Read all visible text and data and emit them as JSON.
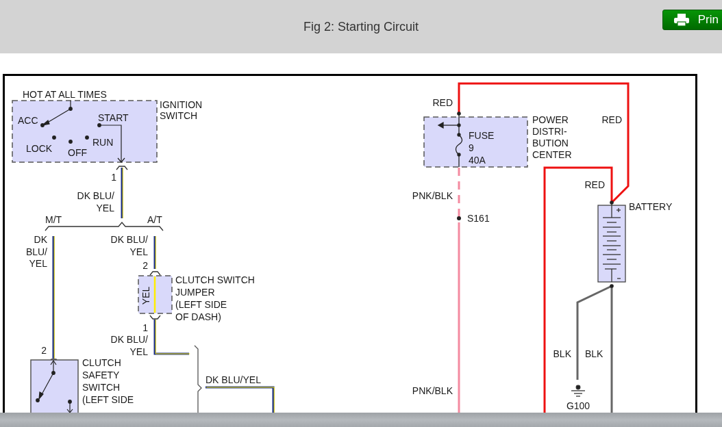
{
  "header": {
    "title": "Fig 2: Starting Circuit",
    "print_button": "Prin"
  },
  "diagram": {
    "labels": [
      {
        "lines": [
          "HOT AT ALL TIMES"
        ]
      },
      {
        "lines": [
          "IGNITION",
          "SWITCH"
        ]
      },
      {
        "lines": [
          "ACC"
        ]
      },
      {
        "lines": [
          "START"
        ]
      },
      {
        "lines": [
          "LOCK"
        ]
      },
      {
        "lines": [
          "OFF"
        ]
      },
      {
        "lines": [
          "RUN"
        ]
      },
      {
        "lines": [
          "1"
        ]
      },
      {
        "lines": [
          "DK BLU/",
          "YEL"
        ]
      },
      {
        "lines": [
          "M/T"
        ]
      },
      {
        "lines": [
          "A/T"
        ]
      },
      {
        "lines": [
          "DK",
          "BLU/",
          "YEL"
        ]
      },
      {
        "lines": [
          "DK BLU/",
          "YEL"
        ]
      },
      {
        "lines": [
          "2"
        ]
      },
      {
        "lines": [
          "CLUTCH SWITCH",
          "JUMPER",
          "(LEFT SIDE",
          "OF DASH)"
        ]
      },
      {
        "lines": [
          "YEL"
        ]
      },
      {
        "lines": [
          "1"
        ]
      },
      {
        "lines": [
          "2"
        ]
      },
      {
        "lines": [
          "DK BLU/",
          "YEL"
        ]
      },
      {
        "lines": [
          "CLUTCH",
          "SAFETY",
          "SWITCH",
          "(LEFT SIDE"
        ]
      },
      {
        "lines": [
          "DK BLU/YEL"
        ]
      },
      {
        "lines": [
          "RED"
        ]
      },
      {
        "lines": [
          "POWER",
          "DISTRI-",
          "BUTION",
          "CENTER"
        ]
      },
      {
        "lines": [
          "FUSE",
          "9",
          "40A"
        ]
      },
      {
        "lines": [
          "RED"
        ]
      },
      {
        "lines": [
          "RED"
        ]
      },
      {
        "lines": [
          "BATTERY"
        ]
      },
      {
        "lines": [
          "PNK/BLK"
        ]
      },
      {
        "lines": [
          "S161"
        ]
      },
      {
        "lines": [
          "PNK/BLK"
        ]
      },
      {
        "lines": [
          "BLK"
        ]
      },
      {
        "lines": [
          "BLK"
        ]
      },
      {
        "lines": [
          "G100"
        ]
      }
    ]
  }
}
